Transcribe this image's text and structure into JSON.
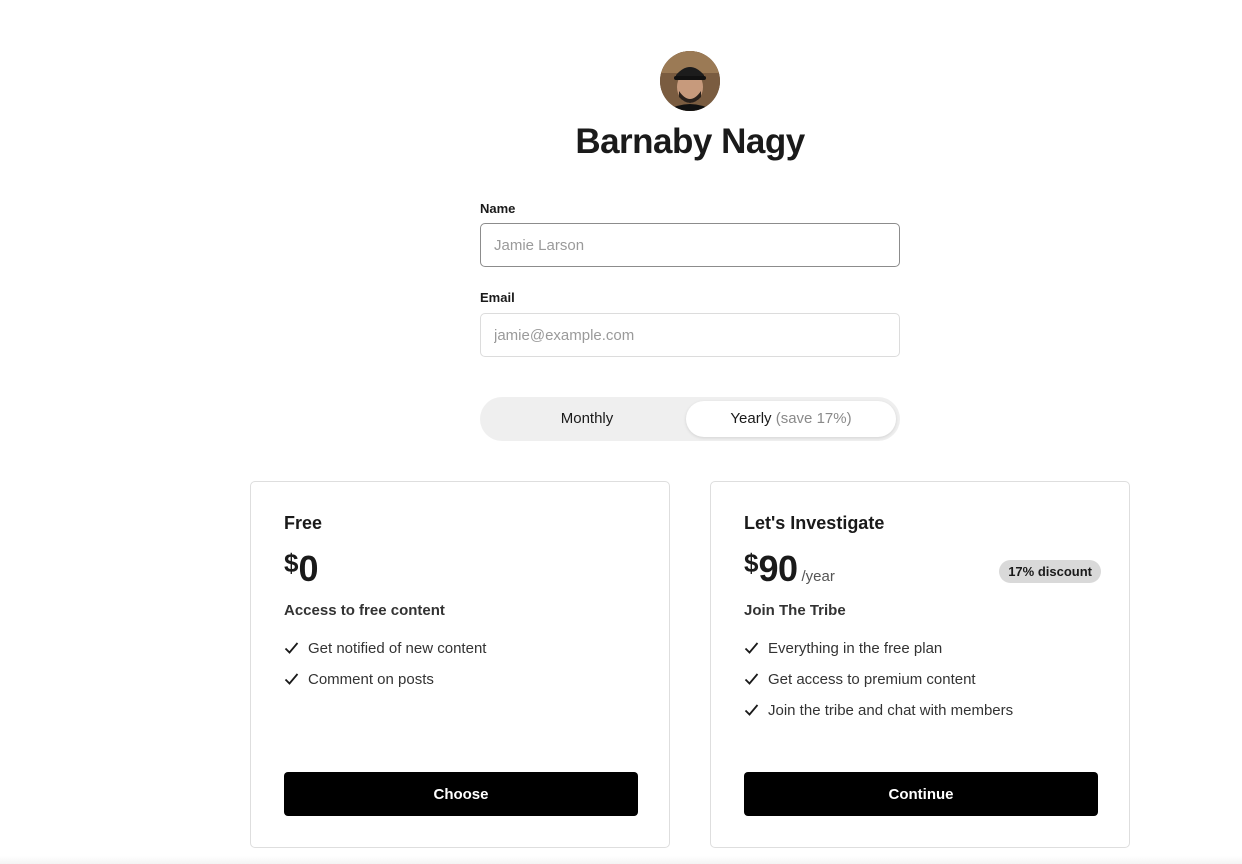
{
  "profile": {
    "name": "Barnaby Nagy",
    "avatar_icon": "profile-photo"
  },
  "form": {
    "name_label": "Name",
    "name_placeholder": "Jamie Larson",
    "name_value": "",
    "email_label": "Email",
    "email_placeholder": "jamie@example.com",
    "email_value": ""
  },
  "billing_toggle": {
    "monthly_label": "Monthly",
    "yearly_label": "Yearly",
    "yearly_note": "(save 17%)",
    "selected": "yearly"
  },
  "plans": [
    {
      "name": "Free",
      "currency": "$",
      "price": "0",
      "period": "",
      "description": "Access to free content",
      "features": [
        "Get notified of new content",
        "Comment on posts"
      ],
      "cta": "Choose"
    },
    {
      "name": "Let's Investigate",
      "currency": "$",
      "price": "90",
      "period": "/year",
      "badge": "17% discount",
      "description": "Join The Tribe",
      "features": [
        "Everything in the free plan",
        "Get access to premium content",
        "Join the tribe and chat with members"
      ],
      "cta": "Continue"
    }
  ],
  "colors": {
    "button_bg": "#000000",
    "button_text": "#ffffff",
    "toggle_bg": "#efefef",
    "badge_bg": "#d9d9d9",
    "border": "#dedede"
  }
}
